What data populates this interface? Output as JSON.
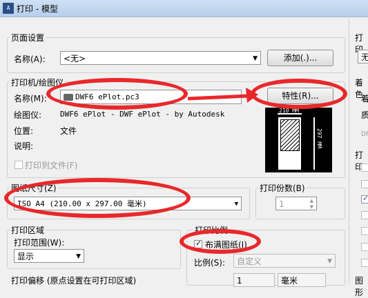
{
  "window": {
    "title": "打印 - 模型",
    "icon_text": "A"
  },
  "page_setup": {
    "group_label": "页面设置",
    "name_label": "名称(A):",
    "name_value": "<无>",
    "add_button": "添加(.)..."
  },
  "printer": {
    "group_label": "打印机/绘图仪",
    "name_label": "名称(M):",
    "name_value": "DWF6 ePlot.pc3",
    "properties_button": "特性(R)...",
    "plotter_label": "绘图仪:",
    "plotter_value": "DWF6 ePlot - DWF ePlot - by Autodesk",
    "location_label": "位置:",
    "location_value": "文件",
    "description_label": "说明:",
    "print_to_file_label": "打印到文件(F)"
  },
  "preview": {
    "width_label": "210 MM",
    "height_label": "297 MM"
  },
  "paper_size": {
    "group_label": "图纸尺寸(Z)",
    "value": "ISO A4 (210.00 x 297.00 毫米)"
  },
  "copies": {
    "group_label": "打印份数(B)",
    "value": "1"
  },
  "plot_area": {
    "group_label": "打印区域",
    "range_label": "打印范围(W):",
    "range_value": "显示"
  },
  "plot_scale": {
    "group_label": "打印比例",
    "fit_paper_label": "布满图纸(I)",
    "scale_label": "比例(S):",
    "scale_value": "自定义",
    "units_value": "1",
    "units_select": "毫米"
  },
  "plot_offset": {
    "group_label": "打印偏移 (原点设置在可打印区域)"
  },
  "right_panel": {
    "print_style_label": "打印",
    "print_style_value": "无",
    "shaded_label": "着色",
    "shaded_sub1": "着",
    "shaded_sub2": "质",
    "shaded_sub3": "DF",
    "options_label": "打印",
    "orientation_label": "图形"
  }
}
